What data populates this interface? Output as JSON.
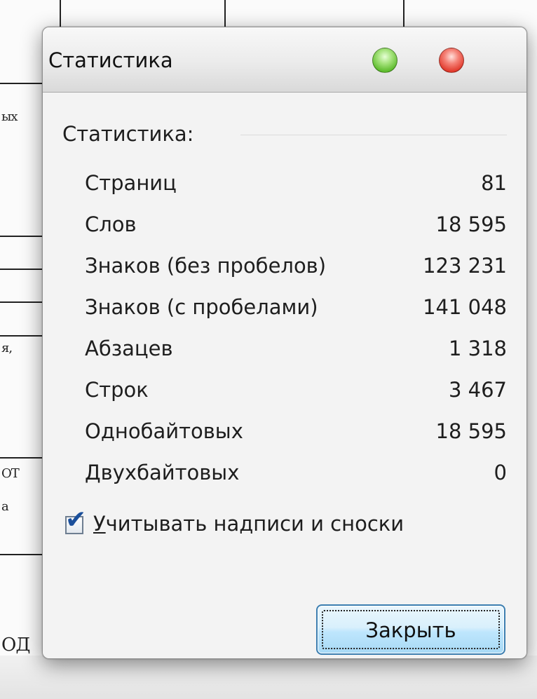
{
  "window": {
    "title": "Статистика"
  },
  "statistics": {
    "group_label": "Статистика:",
    "rows": [
      {
        "label": "Страниц",
        "value": "81"
      },
      {
        "label": "Слов",
        "value": "18 595"
      },
      {
        "label": "Знаков (без пробелов)",
        "value": "123 231"
      },
      {
        "label": "Знаков (с пробелами)",
        "value": "141 048"
      },
      {
        "label": "Абзацев",
        "value": "1 318"
      },
      {
        "label": "Строк",
        "value": "3 467"
      },
      {
        "label": "Однобайтовых",
        "value": "18 595"
      },
      {
        "label": "Двухбайтовых",
        "value": "0"
      }
    ]
  },
  "options": {
    "include_footnotes": {
      "checked": true,
      "label_mnemonic": "У",
      "label_rest": "читывать надписи и сноски"
    }
  },
  "buttons": {
    "close_label": "Закрыть"
  },
  "background_doc": {
    "fragments": [
      "ых",
      "я,",
      "ОТ",
      "а",
      "ОД"
    ]
  },
  "colors": {
    "minimize_button": "#5dbb2c",
    "close_window_button": "#e13a2c",
    "checkbox_mark": "#1a4f9b",
    "button_border": "#3c7fb1"
  }
}
